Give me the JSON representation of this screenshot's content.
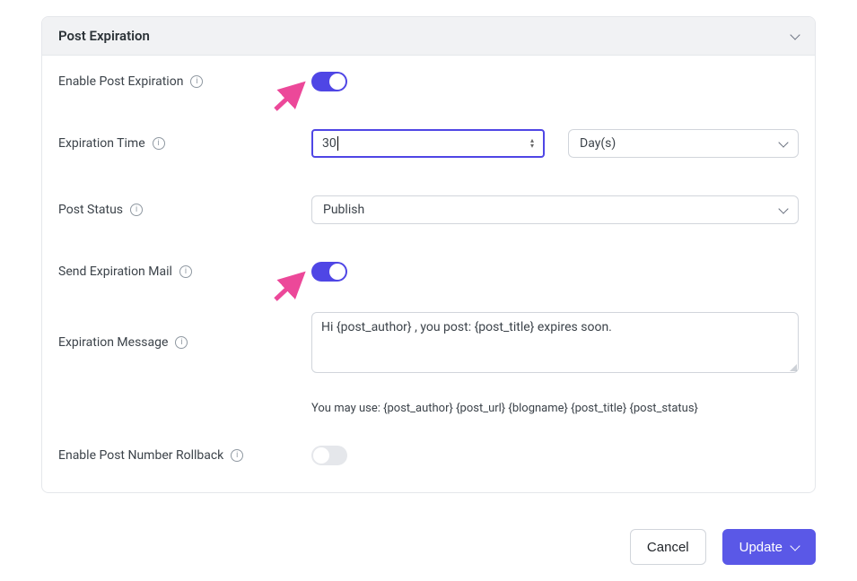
{
  "panel": {
    "title": "Post Expiration"
  },
  "labels": {
    "enable": "Enable Post Expiration",
    "time": "Expiration Time",
    "status": "Post Status",
    "mail": "Send Expiration Mail",
    "message": "Expiration Message",
    "rollback": "Enable Post Number Rollback"
  },
  "fields": {
    "enable_on": true,
    "time_value": "30",
    "time_unit": "Day(s)",
    "status": "Publish",
    "mail_on": true,
    "message": "Hi {post_author} , you post: {post_title} expires soon.",
    "message_hint": "You may use: {post_author} {post_url} {blogname} {post_title} {post_status}",
    "rollback_on": false
  },
  "actions": {
    "cancel": "Cancel",
    "update": "Update"
  },
  "icons": {
    "info_glyph": "i"
  },
  "annotations": {
    "arrow_color": "#ec4899"
  }
}
